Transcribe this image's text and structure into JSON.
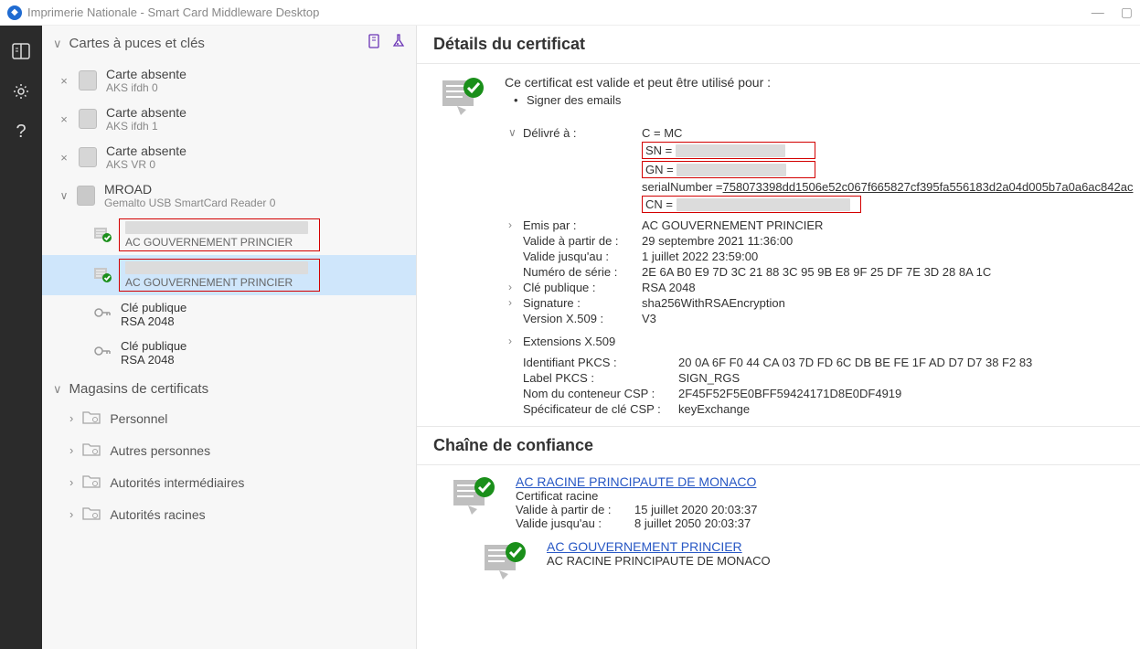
{
  "window": {
    "title": "Imprimerie Nationale - Smart Card Middleware Desktop"
  },
  "sidebar": {
    "header": "Cartes à puces et clés",
    "slots": [
      {
        "title": "Carte absente",
        "subtitle": "AKS ifdh 0",
        "dismissable": true
      },
      {
        "title": "Carte absente",
        "subtitle": "AKS ifdh 1",
        "dismissable": true
      },
      {
        "title": "Carte absente",
        "subtitle": "AKS VR 0",
        "dismissable": true
      }
    ],
    "mroad": {
      "title": "MROAD",
      "subtitle": "Gemalto USB SmartCard Reader 0",
      "certs": [
        {
          "issuer": "AC GOUVERNEMENT PRINCIER",
          "selected": false
        },
        {
          "issuer": "AC GOUVERNEMENT PRINCIER",
          "selected": true
        }
      ],
      "keys": [
        {
          "title": "Clé publique",
          "subtitle": "RSA 2048"
        },
        {
          "title": "Clé publique",
          "subtitle": "RSA 2048"
        }
      ]
    },
    "stores_header": "Magasins de certificats",
    "stores": [
      {
        "label": "Personnel"
      },
      {
        "label": "Autres personnes"
      },
      {
        "label": "Autorités intermédiaires"
      },
      {
        "label": "Autorités racines"
      }
    ]
  },
  "details": {
    "title": "Détails du certificat",
    "valid_intro": "Ce certificat est valide et peut être utilisé pour :",
    "usage_bullet": "Signer des emails",
    "delivered_label": "Délivré à :",
    "dn": {
      "c": "C = MC",
      "sn_label": "SN =",
      "gn_label": "GN =",
      "serial_label": "serialNumber = ",
      "serial_value": "758073398dd1506e52c067f665827cf395fa556183d2a04d005b7a0a6ac842ac",
      "cn_label": "CN ="
    },
    "issued_by_label": "Emis par :",
    "issued_by_value": "AC GOUVERNEMENT PRINCIER",
    "valid_from_label": "Valide à partir de :",
    "valid_from_value": "29 septembre 2021 11:36:00",
    "valid_to_label": "Valide jusqu'au :",
    "valid_to_value": "1 juillet 2022 23:59:00",
    "serial_no_label": "Numéro de série :",
    "serial_no_value": "2E 6A B0 E9 7D 3C 21 88 3C 95 9B E8 9F 25 DF 7E 3D 28 8A 1C",
    "pubkey_label": "Clé publique :",
    "pubkey_value": "RSA 2048",
    "sig_label": "Signature :",
    "sig_value": "sha256WithRSAEncryption",
    "ver_label": "Version X.509 :",
    "ver_value": "V3",
    "ext_label": "Extensions X.509",
    "pkcs_id_label": "Identifiant PKCS :",
    "pkcs_id_value": "20 0A 6F F0 44 CA 03 7D FD 6C DB BE FE 1F AD D7 D7 38 F2 83",
    "pkcs_label_label": "Label PKCS :",
    "pkcs_label_value": "SIGN_RGS",
    "csp_container_label": "Nom du conteneur CSP :",
    "csp_container_value": "2F45F52F5E0BFF59424171D8E0DF4919",
    "csp_keyspec_label": "Spécificateur de clé CSP :",
    "csp_keyspec_value": "keyExchange"
  },
  "chain": {
    "title": "Chaîne de confiance",
    "items": [
      {
        "name": "AC RACINE PRINCIPAUTE DE MONACO",
        "role": "Certificat racine",
        "valid_from_label": "Valide à partir de :",
        "valid_from_value": "15 juillet 2020 20:03:37",
        "valid_to_label": "Valide jusqu'au :",
        "valid_to_value": "8 juillet 2050 20:03:37"
      },
      {
        "name": "AC GOUVERNEMENT PRINCIER",
        "role": "AC RACINE PRINCIPAUTE DE MONACO"
      }
    ]
  }
}
